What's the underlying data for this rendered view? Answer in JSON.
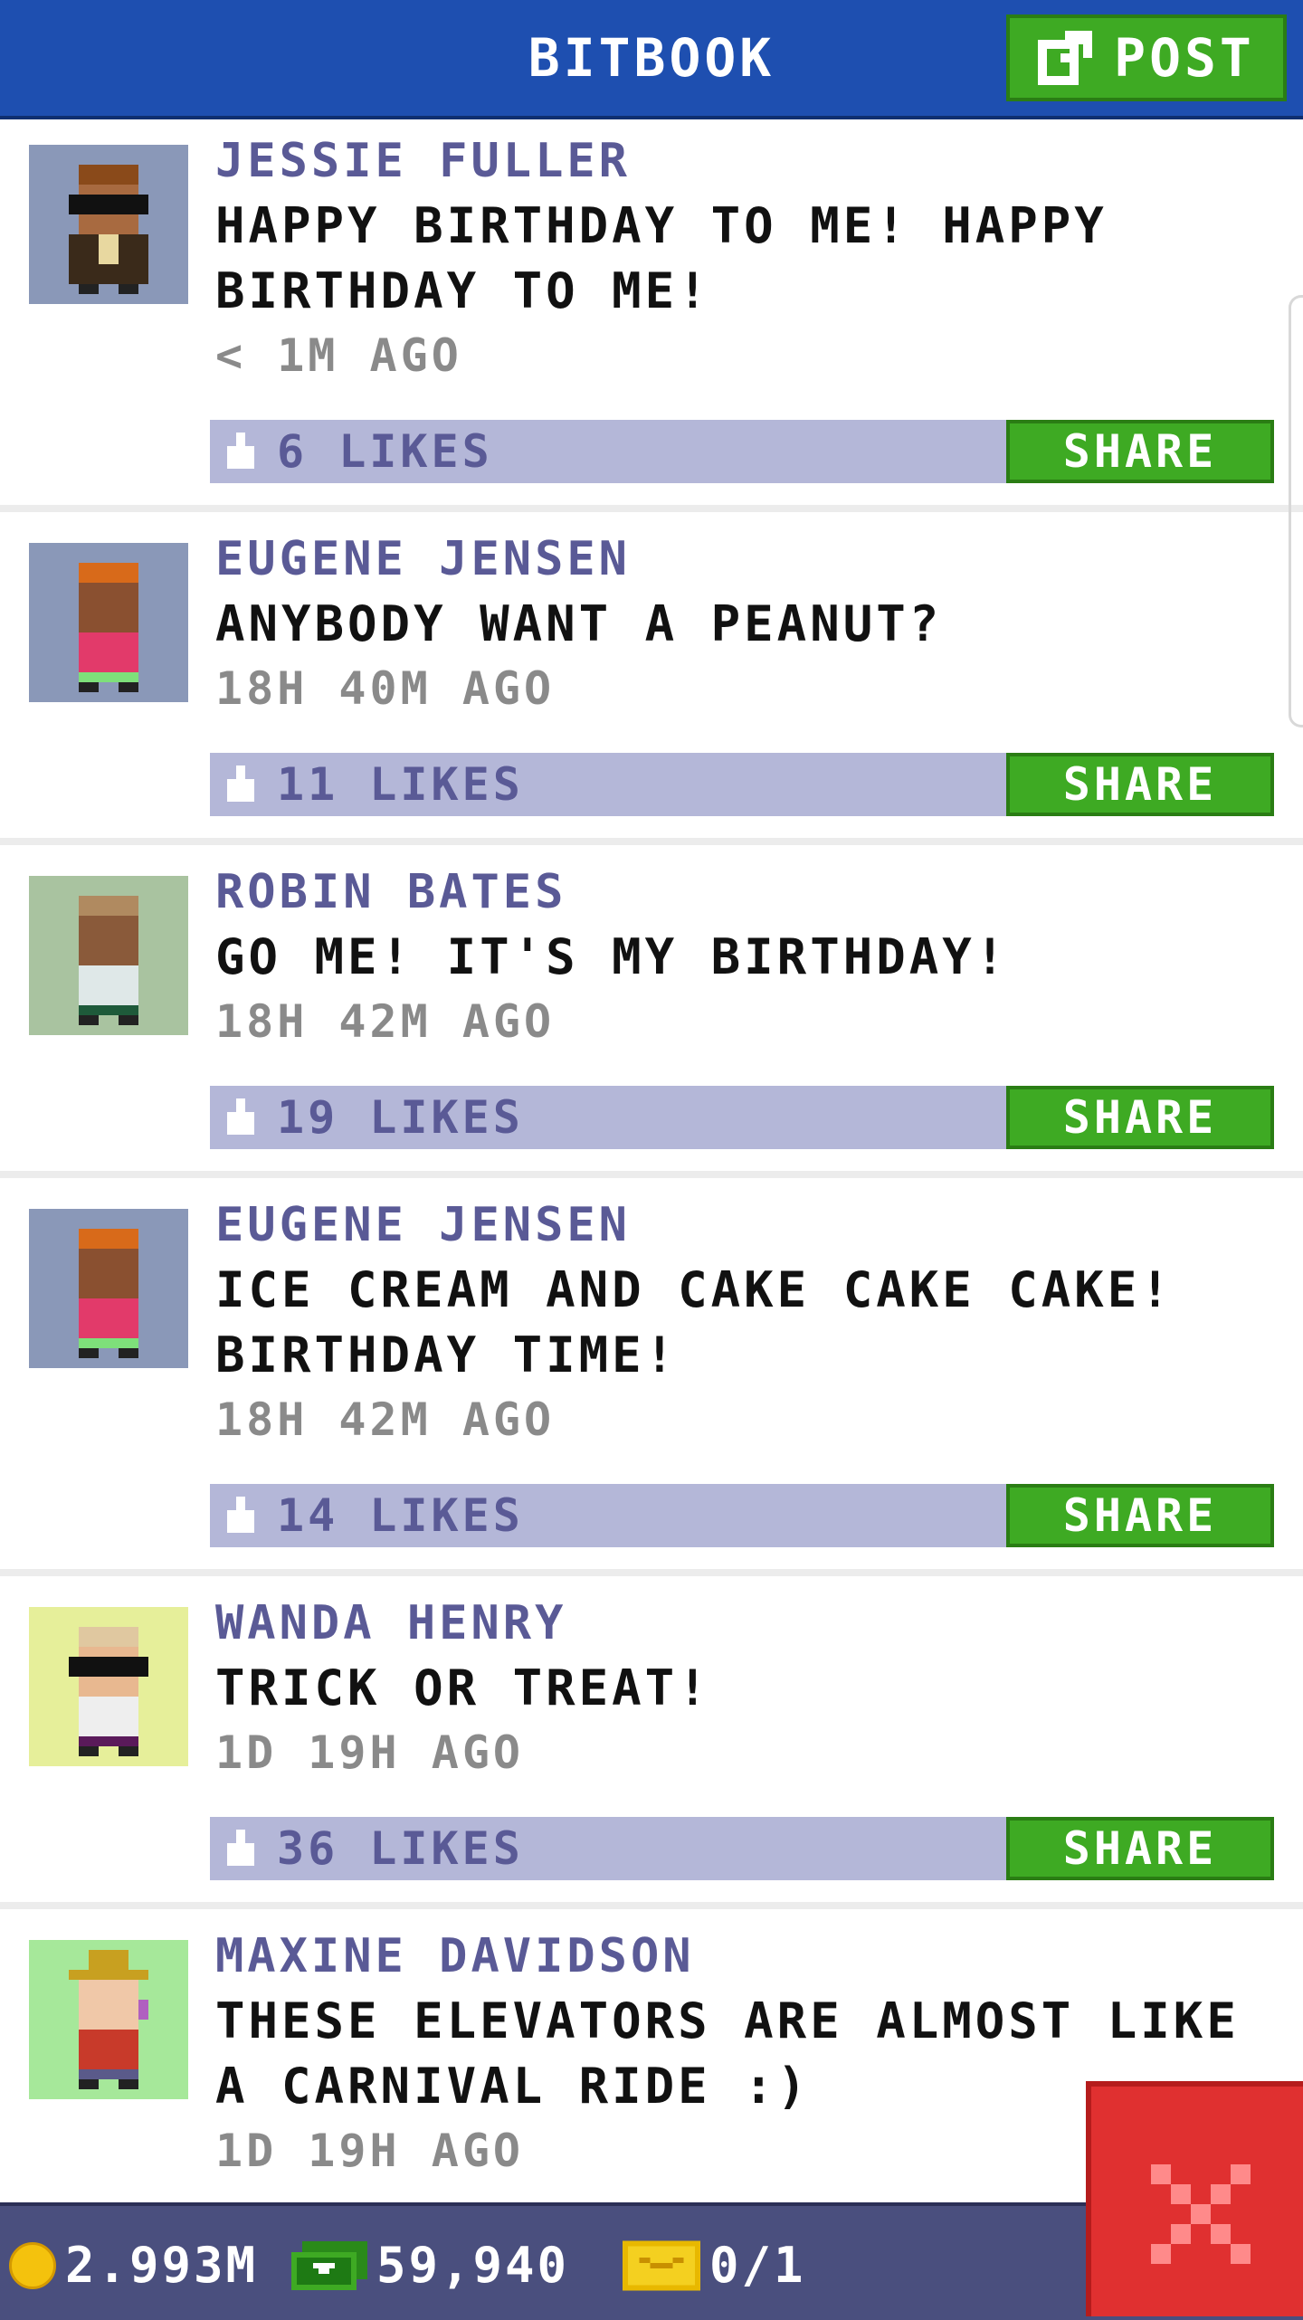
{
  "header": {
    "title": "BITBOOK",
    "post_label": "POST"
  },
  "posts": [
    {
      "author": "JESSIE FULLER",
      "message": "HAPPY BIRTHDAY TO ME! HAPPY BIRTHDAY TO ME!",
      "time": "< 1M AGO",
      "likes": "6 LIKES",
      "share_label": "SHARE",
      "avatar_bg": "#8a98b8"
    },
    {
      "author": "EUGENE JENSEN",
      "message": "ANYBODY WANT A PEANUT?",
      "time": "18H 40M AGO",
      "likes": "11 LIKES",
      "share_label": "SHARE",
      "avatar_bg": "#8a98b8"
    },
    {
      "author": "ROBIN BATES",
      "message": "GO ME! IT'S MY BIRTHDAY!",
      "time": "18H 42M AGO",
      "likes": "19 LIKES",
      "share_label": "SHARE",
      "avatar_bg": "#a9c3a0"
    },
    {
      "author": "EUGENE JENSEN",
      "message": "ICE CREAM AND CAKE CAKE CAKE! BIRTHDAY TIME!",
      "time": "18H 42M AGO",
      "likes": "14 LIKES",
      "share_label": "SHARE",
      "avatar_bg": "#8a98b8"
    },
    {
      "author": "WANDA HENRY",
      "message": "TRICK OR TREAT!",
      "time": "1D 19H AGO",
      "likes": "36 LIKES",
      "share_label": "SHARE",
      "avatar_bg": "#e6ef9a"
    },
    {
      "author": "MAXINE DAVIDSON",
      "message": "THESE ELEVATORS ARE ALMOST LIKE A CARNIVAL RIDE :)",
      "time": "1D 19H AGO",
      "avatar_bg": "#a6e89a"
    }
  ],
  "footer": {
    "coins": "2.993M",
    "bux": "59,940",
    "tickets": "0/1"
  },
  "colors": {
    "header": "#1e4fb0",
    "green_button": "#3eaa23",
    "likes_bar": "#b4b7d8",
    "close_button": "#e03030"
  },
  "icons": {
    "post": "edit-icon",
    "like": "thumbs-up-icon",
    "close": "close-icon",
    "coin": "coin-icon",
    "cash": "cash-icon",
    "ticket": "ticket-icon"
  }
}
